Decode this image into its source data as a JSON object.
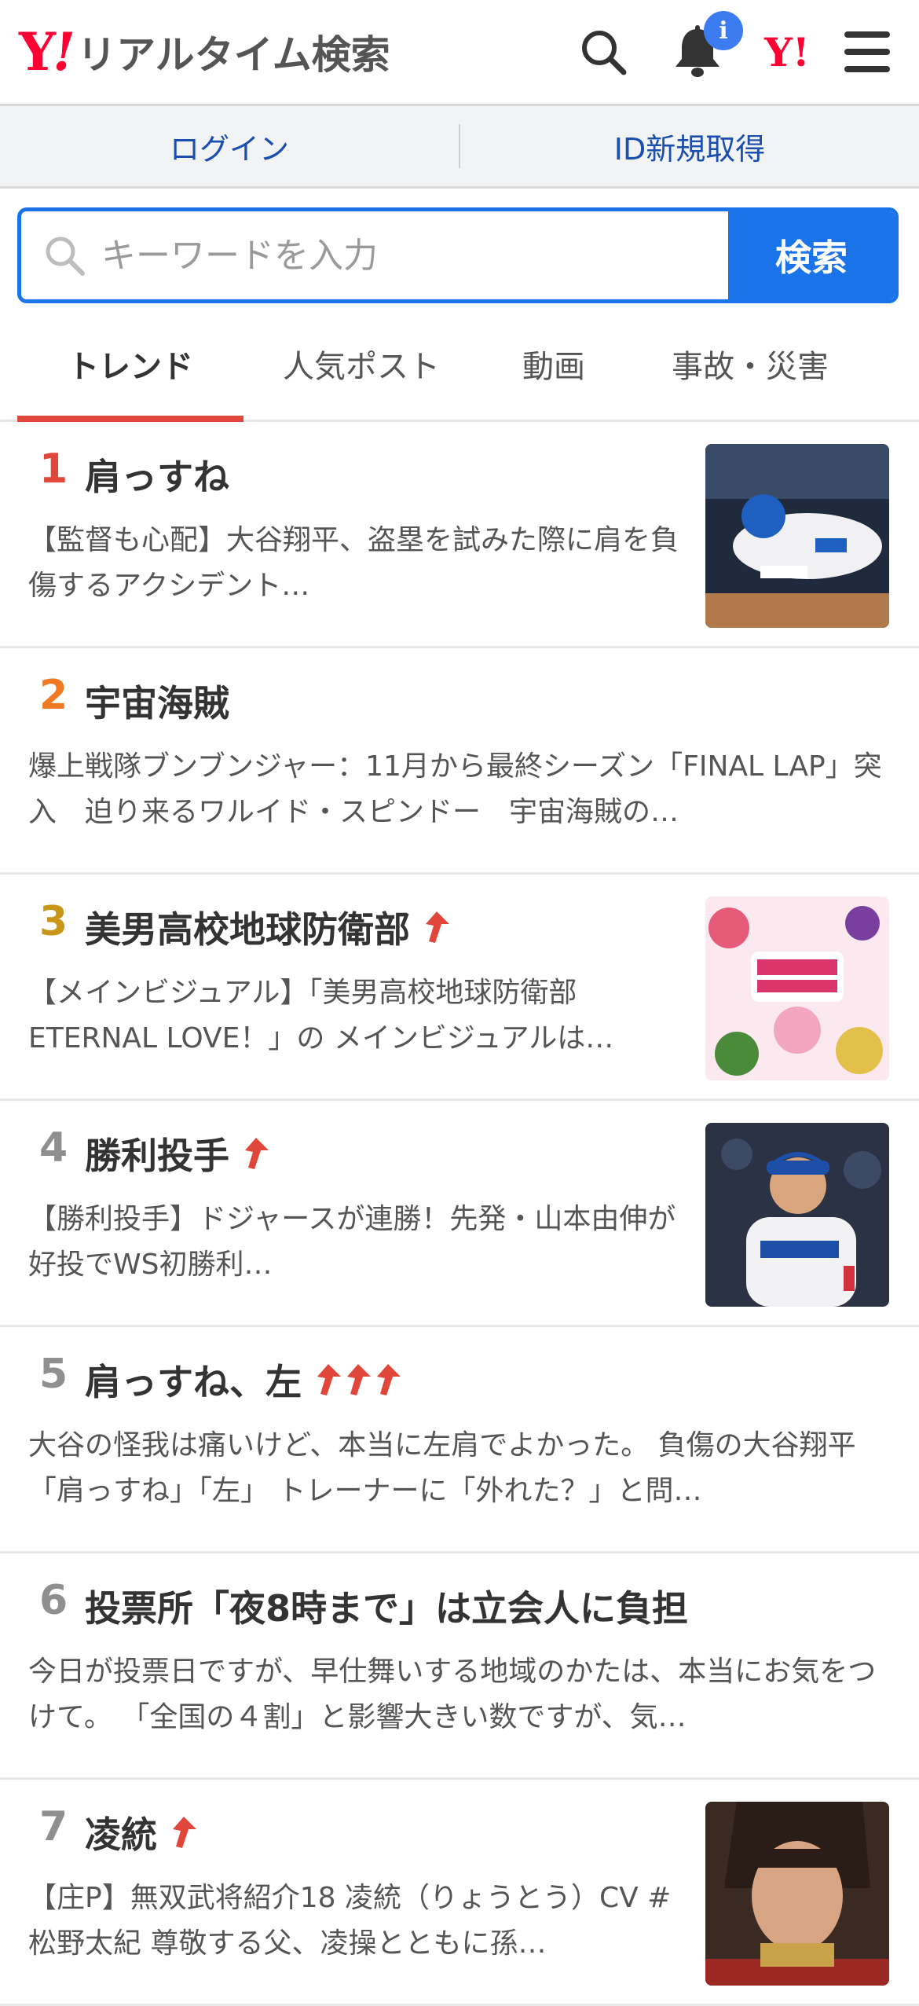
{
  "header": {
    "logo_y": "Y",
    "logo_ex": "!",
    "logo_text": "リアルタイム検索",
    "notification_badge": "i",
    "yj_logo": "Y!",
    "icons": [
      "search-icon",
      "bell-icon",
      "yahoo-japan-icon",
      "hamburger-menu-icon"
    ]
  },
  "loginbar": {
    "login": "ログイン",
    "signup": "ID新規取得"
  },
  "search": {
    "placeholder": "キーワードを入力",
    "button": "検索"
  },
  "tabs": [
    {
      "label": "トレンド",
      "active": true
    },
    {
      "label": "人気ポスト",
      "active": false
    },
    {
      "label": "動画",
      "active": false
    },
    {
      "label": "事故・災害",
      "active": false
    }
  ],
  "colors": {
    "brand_red": "#ff0033",
    "accent_blue": "#1a73e8",
    "tab_underline": "#e0463a",
    "rank1": "#e0463a",
    "rank2": "#f07a24",
    "rank3": "#c9961a",
    "rank_other": "#8f8f8f",
    "up_arrow": "#e0463a"
  },
  "trends": [
    {
      "rank": "1",
      "keyword": "肩っすね",
      "arrows": 0,
      "thumb": "baseball-player-sliding",
      "desc": "【監督も心配】大谷翔平、盗塁を試みた際に肩を負傷するアクシデント…"
    },
    {
      "rank": "2",
      "keyword": "宇宙海賊",
      "arrows": 0,
      "thumb": null,
      "desc": "爆上戦隊ブンブンジャー：11月から最終シーズン「FINAL LAP」突入　迫り来るワルイド・スピンドー　宇宙海賊の…"
    },
    {
      "rank": "3",
      "keyword": "美男高校地球防衛部",
      "arrows": 1,
      "thumb": "anime-key-visual",
      "desc": "【メインビジュアル】「美男高校地球防衛部 ETERNAL LOVE！」の メインビジュアルは…"
    },
    {
      "rank": "4",
      "keyword": "勝利投手",
      "arrows": 1,
      "thumb": "dodgers-pitcher",
      "desc": "【勝利投手】ドジャースが連勝！先発・山本由伸が好投でWS初勝利…"
    },
    {
      "rank": "5",
      "keyword": "肩っすね、左",
      "arrows": 3,
      "thumb": null,
      "desc": "大谷の怪我は痛いけど、本当に左肩でよかった。 負傷の大谷翔平「肩っすね」「左」 トレーナーに「外れた？」と問…"
    },
    {
      "rank": "6",
      "keyword": "投票所「夜8時まで」は立会人に負担",
      "arrows": 0,
      "thumb": null,
      "desc": "今日が投票日ですが、早仕舞いする地域のかたは、本当にお気をつけて。 「全国の４割」と影響大きい数ですが、気…"
    },
    {
      "rank": "7",
      "keyword": "凌統",
      "arrows": 1,
      "thumb": "game-character-portrait",
      "desc": "【庄P】無双武将紹介18 凌統（りょうとう）CV #松野太紀 尊敬する父、凌操とともに孫…"
    }
  ]
}
